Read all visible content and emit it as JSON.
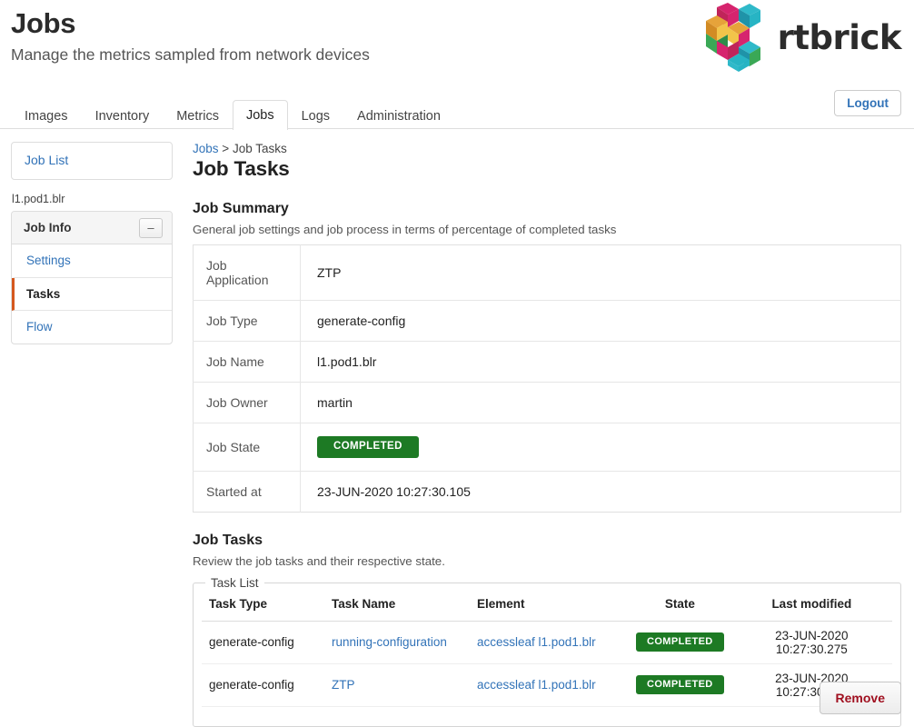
{
  "header": {
    "title": "Jobs",
    "subtitle": "Manage the metrics sampled from network devices",
    "brand_name": "rtbrick",
    "logo_colors": {
      "magenta": "#d6246e",
      "pink": "#e0436f",
      "crimson": "#c0245a",
      "cyan": "#27b4c4",
      "teal": "#1f93a8",
      "green": "#3aa856",
      "green_dark": "#2e8c4a",
      "orange": "#e6a33a",
      "gold": "#d28b24",
      "yellow": "#f2c44a"
    }
  },
  "nav": {
    "tabs": [
      {
        "label": "Images",
        "active": false
      },
      {
        "label": "Inventory",
        "active": false
      },
      {
        "label": "Metrics",
        "active": false
      },
      {
        "label": "Jobs",
        "active": true
      },
      {
        "label": "Logs",
        "active": false
      },
      {
        "label": "Administration",
        "active": false
      }
    ],
    "logout_label": "Logout"
  },
  "sidebar": {
    "job_list_label": "Job List",
    "context_label": "l1.pod1.blr",
    "panel": {
      "title": "Job Info",
      "collapse_icon": "minus-icon",
      "collapse_glyph": "–",
      "items": [
        {
          "label": "Settings",
          "active": false
        },
        {
          "label": "Tasks",
          "active": true
        },
        {
          "label": "Flow",
          "active": false
        }
      ]
    }
  },
  "main": {
    "breadcrumb": {
      "root": "Jobs",
      "separator": ">",
      "current": "Job Tasks"
    },
    "view_title": "Job Tasks",
    "summary": {
      "section_title": "Job Summary",
      "section_desc": "General job settings and job process in terms of percentage of completed tasks",
      "rows": [
        {
          "key": "Job Application",
          "value": "ZTP",
          "type": "text"
        },
        {
          "key": "Job Type",
          "value": "generate-config",
          "type": "text"
        },
        {
          "key": "Job Name",
          "value": "l1.pod1.blr",
          "type": "text"
        },
        {
          "key": "Job Owner",
          "value": "martin",
          "type": "text"
        },
        {
          "key": "Job State",
          "value": "COMPLETED",
          "type": "badge"
        },
        {
          "key": "Started at",
          "value": "23-JUN-2020 10:27:30.105",
          "type": "text"
        }
      ]
    },
    "tasks": {
      "section_title": "Job Tasks",
      "section_desc": "Review the job tasks and their respective state.",
      "legend": "Task List",
      "columns": [
        "Task Type",
        "Task Name",
        "Element",
        "State",
        "Last modified"
      ],
      "rows": [
        {
          "task_type": "generate-config",
          "task_name": "running-configuration",
          "element": "accessleaf l1.pod1.blr",
          "state": "COMPLETED",
          "last_modified": "23-JUN-2020 10:27:30.275"
        },
        {
          "task_type": "generate-config",
          "task_name": "ZTP",
          "element": "accessleaf l1.pod1.blr",
          "state": "COMPLETED",
          "last_modified": "23-JUN-2020 10:27:30.351"
        }
      ]
    }
  },
  "footer": {
    "remove_label": "Remove"
  },
  "colors": {
    "link": "#3273b8",
    "badge_green": "#1d7a24",
    "active_marker": "#d4581e",
    "danger_text": "#a01020"
  }
}
